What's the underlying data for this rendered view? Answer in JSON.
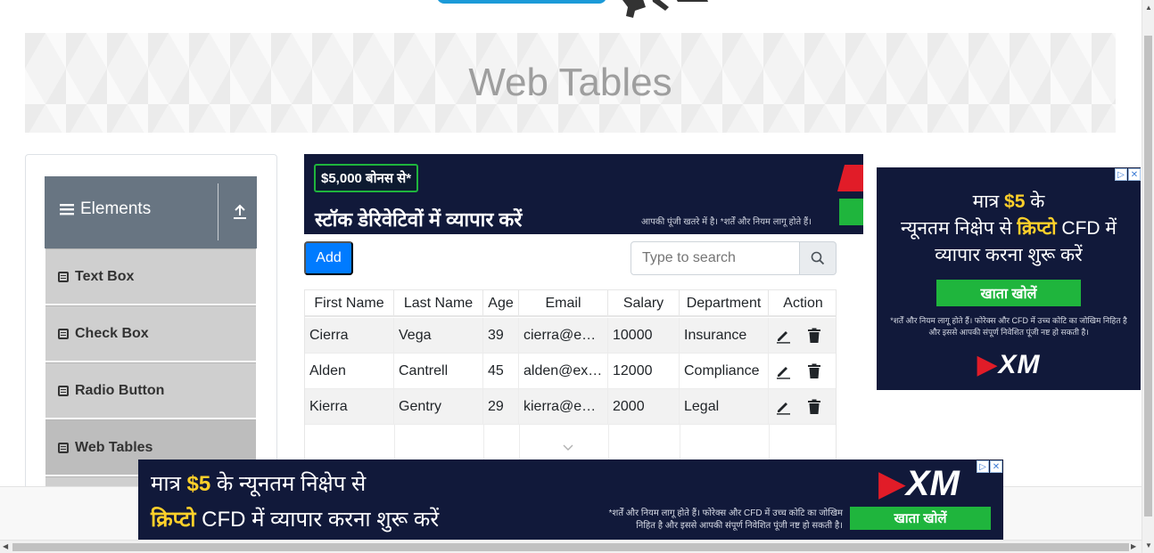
{
  "header": {
    "title": "Web Tables"
  },
  "sidebar": {
    "group_label": "Elements",
    "items": [
      {
        "label": "Text Box",
        "active": false
      },
      {
        "label": "Check Box",
        "active": false
      },
      {
        "label": "Radio Button",
        "active": false
      },
      {
        "label": "Web Tables",
        "active": true
      }
    ]
  },
  "toolbar": {
    "add_label": "Add",
    "search_placeholder": "Type to search",
    "search_value": ""
  },
  "table": {
    "columns": [
      "First Name",
      "Last Name",
      "Age",
      "Email",
      "Salary",
      "Department",
      "Action"
    ],
    "rows": [
      {
        "first": "Cierra",
        "last": "Vega",
        "age": "39",
        "email": "cierra@e…",
        "salary": "10000",
        "department": "Insurance"
      },
      {
        "first": "Alden",
        "last": "Cantrell",
        "age": "45",
        "email": "alden@ex…",
        "salary": "12000",
        "department": "Compliance"
      },
      {
        "first": "Kierra",
        "last": "Gentry",
        "age": "29",
        "email": "kierra@e…",
        "salary": "2000",
        "department": "Legal"
      }
    ]
  },
  "ads": {
    "top": {
      "badge": "$5,000 बोनस से*",
      "headline": "स्टॉक डेरिवेटिवों में व्यापार करें",
      "disclaimer": "आपकी पूंजी खतरे में है। *शर्तें और नियम लागू होते हैं।"
    },
    "right": {
      "line1_prefix": "मात्र",
      "line1_amount": "$5",
      "line1_suffix": "के",
      "line2_prefix": "न्यूनतम निक्षेप से",
      "line2_highlight": "क्रिप्टो",
      "line2_suffix": "CFD में",
      "line3": "व्यापार करना शुरू करें",
      "cta": "खाता खोलें",
      "fine": "*शर्तें और नियम लागू होते हैं। फोरेक्स और CFD में उच्च कोटि का जोखिम निहित है और इससे आपकी संपूर्ण निवेशित पूंजी नष्ट हो सकती है।",
      "brand": "XM"
    },
    "bottom": {
      "line1_prefix": "मात्र",
      "line1_amount": "$5",
      "line1_suffix": "के न्यूनतम निक्षेप से",
      "line2_highlight": "क्रिप्टो",
      "line2_suffix": "CFD में व्यापार करना शुरू करें",
      "fine": "*शर्तें और नियम लागू होते हैं। फोरेक्स और CFD में उच्च कोटि का जोखिम निहित है और इससे आपकी संपूर्ण निवेशित पूंजी नष्ट हो सकती है।",
      "cta": "खाता खोलें",
      "brand": "XM"
    }
  },
  "colors": {
    "accent": "#007bff",
    "sidebar_header": "#687582",
    "ad_bg": "#11193a",
    "ad_cta": "#1fb53d",
    "ad_highlight": "#ffd02a"
  },
  "icons": {
    "menu": "hamburger-icon",
    "collapse": "upload-arrow-icon",
    "item": "list-icon",
    "search": "search-icon",
    "edit": "pencil-icon",
    "delete": "trash-icon"
  }
}
